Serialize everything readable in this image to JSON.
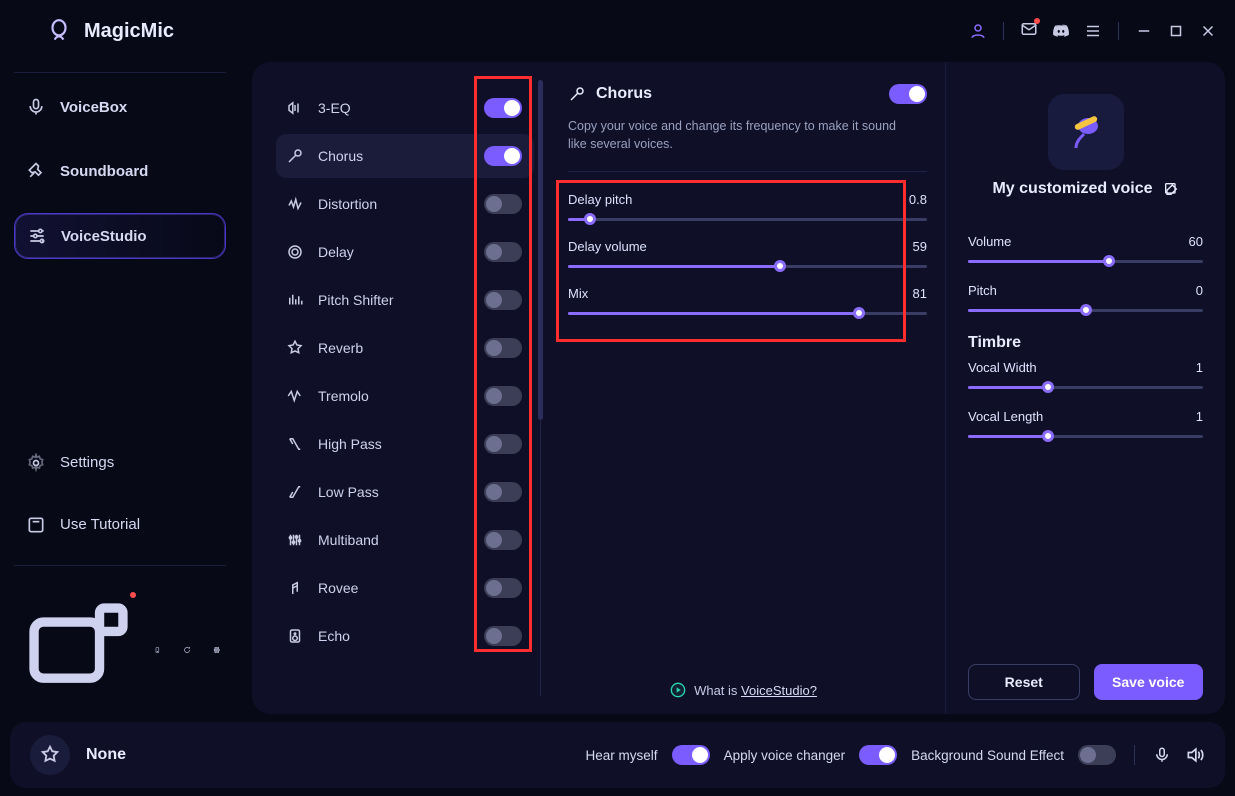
{
  "app": {
    "title": "MagicMic"
  },
  "sidebar": {
    "items": [
      {
        "label": "VoiceBox"
      },
      {
        "label": "Soundboard"
      },
      {
        "label": "VoiceStudio"
      }
    ],
    "bottom": [
      {
        "label": "Settings"
      },
      {
        "label": "Use Tutorial"
      }
    ]
  },
  "effects": [
    {
      "label": "3-EQ",
      "on": true
    },
    {
      "label": "Chorus",
      "on": true,
      "active": true
    },
    {
      "label": "Distortion",
      "on": false
    },
    {
      "label": "Delay",
      "on": false
    },
    {
      "label": "Pitch Shifter",
      "on": false
    },
    {
      "label": "Reverb",
      "on": false
    },
    {
      "label": "Tremolo",
      "on": false
    },
    {
      "label": "High Pass",
      "on": false
    },
    {
      "label": "Low Pass",
      "on": false
    },
    {
      "label": "Multiband",
      "on": false
    },
    {
      "label": "Rovee",
      "on": false
    },
    {
      "label": "Echo",
      "on": false
    }
  ],
  "detail": {
    "title": "Chorus",
    "on": true,
    "desc": "Copy your voice and change its frequency to make it sound like several voices.",
    "params": [
      {
        "label": "Delay pitch",
        "value": "0.8",
        "pct": 6
      },
      {
        "label": "Delay volume",
        "value": "59",
        "pct": 59
      },
      {
        "label": "Mix",
        "value": "81",
        "pct": 81
      }
    ],
    "whatis_prefix": "What is ",
    "whatis_link": "VoiceStudio?"
  },
  "right": {
    "voice_name": "My customized voice",
    "volume": {
      "label": "Volume",
      "value": "60",
      "pct": 60
    },
    "pitch": {
      "label": "Pitch",
      "value": "0",
      "pct": 50
    },
    "timbre_label": "Timbre",
    "vocal_width": {
      "label": "Vocal Width",
      "value": "1",
      "pct": 34
    },
    "vocal_length": {
      "label": "Vocal Length",
      "value": "1",
      "pct": 34
    },
    "reset": "Reset",
    "save": "Save voice"
  },
  "bottom": {
    "preset": "None",
    "hear": "Hear myself",
    "hear_on": true,
    "apply": "Apply voice changer",
    "apply_on": true,
    "bg": "Background Sound Effect",
    "bg_on": false
  }
}
